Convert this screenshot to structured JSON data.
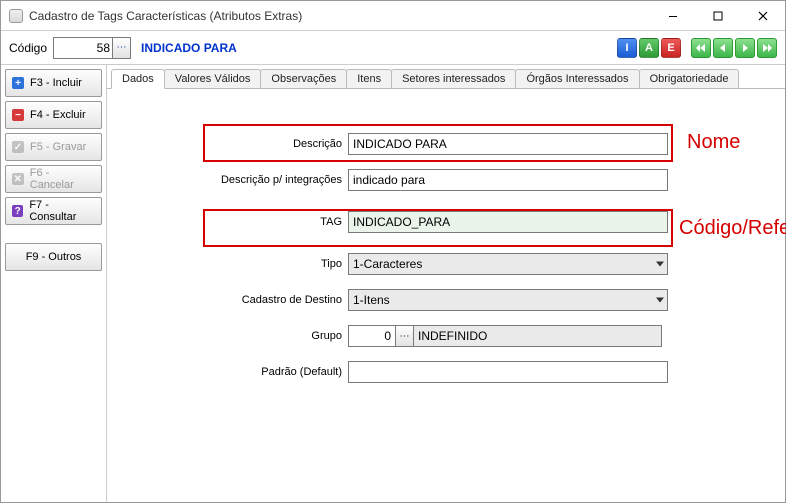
{
  "window": {
    "title": "Cadastro de Tags Características (Atributos Extras)"
  },
  "toolbar": {
    "codigo_label": "Código",
    "codigo_value": "58",
    "entity_name": "INDICADO PARA",
    "btn_i": "I",
    "btn_a": "A",
    "btn_e": "E"
  },
  "sidebar": {
    "incluir": {
      "icon": "+",
      "label": "F3 - Incluir"
    },
    "excluir": {
      "icon": "−",
      "label": "F4 - Excluir"
    },
    "gravar": {
      "icon": "✓",
      "label": "F5 - Gravar"
    },
    "cancelar": {
      "icon": "✕",
      "label": "F6 - Cancelar"
    },
    "consultar": {
      "icon": "?",
      "label": "F7 - Consultar"
    },
    "outros": {
      "label": "F9 - Outros"
    }
  },
  "tabs": {
    "dados": "Dados",
    "valores": "Valores Válidos",
    "observacoes": "Observações",
    "itens": "Itens",
    "setores": "Setores interessados",
    "orgaos": "Órgãos Interessados",
    "obrigatoriedade": "Obrigatoriedade"
  },
  "form": {
    "descricao_label": "Descrição",
    "descricao_value": "INDICADO PARA",
    "descricao_int_label": "Descrição p/ integrações",
    "descricao_int_value": "indicado para",
    "tag_label": "TAG",
    "tag_value": "INDICADO_PARA",
    "tipo_label": "Tipo",
    "tipo_value": "1-Caracteres",
    "destino_label": "Cadastro de Destino",
    "destino_value": "1-Itens",
    "grupo_label": "Grupo",
    "grupo_code": "0",
    "grupo_display": "INDEFINIDO",
    "padrao_label": "Padrão (Default)",
    "padrao_value": ""
  },
  "annotations": {
    "nome": "Nome",
    "codigo_ref": "Código/Referência"
  }
}
